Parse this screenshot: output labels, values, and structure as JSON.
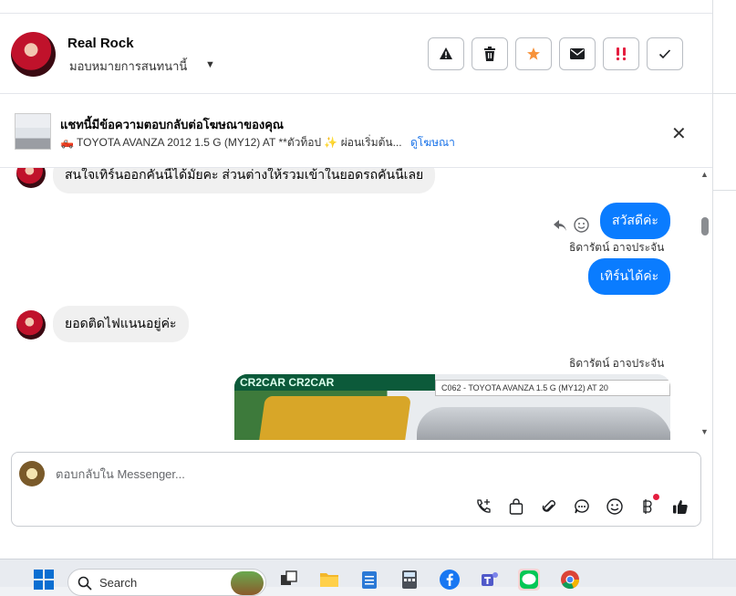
{
  "header": {
    "name": "Real Rock",
    "assign_label": "มอบหมายการสนทนานี้",
    "action_buttons": [
      "report-icon",
      "trash-icon",
      "star-icon",
      "mail-icon",
      "priority-icon",
      "check-icon"
    ]
  },
  "ad_bar": {
    "title": "แชทนี้มีข้อความตอบกลับต่อโฆษณาของคุณ",
    "subtitle": "🛻 TOYOTA AVANZA 2012 1.5 G (MY12) AT **ตัวท็อป ✨ ผ่อนเริ่มต้น...",
    "link": "ดูโฆษณา"
  },
  "messages": {
    "in_1": "สนใจเทิร์นออกคันนี้ได้มั้ยคะ ส่วนต่างให้รวมเข้าในยอดรถคันนี้เลย",
    "out_1": "สวัสดีค่ะ",
    "sender_1": "ธิดารัตน์ อาจประจัน",
    "out_2": "เทิร์นได้ค่ะ",
    "in_2": "ยอดติดไฟแนนอยู่ค่ะ",
    "sender_2": "ธิดารัตน์ อาจประจัน",
    "ad_image_banner": "CR2CAR CR2CAR",
    "ad_image_code": "C062 - TOYOTA AVANZA 1.5 G (MY12) AT 20"
  },
  "composer": {
    "placeholder": "ตอบกลับใน Messenger..."
  },
  "taskbar": {
    "search_label": "Search"
  },
  "colors": {
    "accent": "#0a7cff",
    "star": "#f7923a",
    "badge": "#e41e3f"
  }
}
